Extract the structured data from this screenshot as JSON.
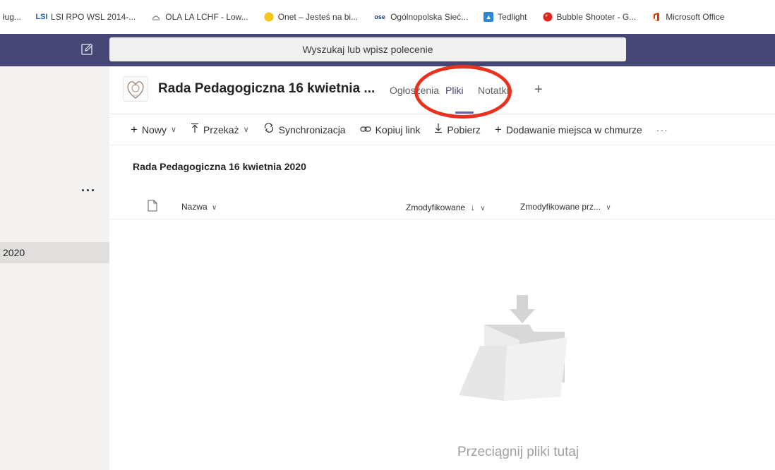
{
  "bookmarks": [
    {
      "label": "ług...",
      "icon": "bookmark-icon",
      "color": "#6b6b6b"
    },
    {
      "label": "LSI RPO WSL 2014-...",
      "icon": "lsi-logo-icon",
      "color": "#1f5ea8"
    },
    {
      "label": "OLA LA LCHF - Low...",
      "icon": "ola-icon",
      "color": "#8c8c8c"
    },
    {
      "label": "Onet – Jesteś na bi...",
      "icon": "onet-icon",
      "color": "#f5c518"
    },
    {
      "label": "Ogólnopolska Sieć...",
      "icon": "ose-icon",
      "color": "#1a3b73"
    },
    {
      "label": "Tedlight",
      "icon": "tedlight-icon",
      "color": "#2b88d8"
    },
    {
      "label": "Bubble Shooter - G...",
      "icon": "bubble-icon",
      "color": "#d9281e"
    },
    {
      "label": "Microsoft Office",
      "icon": "office-icon",
      "color": "#d83b01"
    }
  ],
  "topbar": {
    "search_placeholder": "Wyszukaj lub wpisz polecenie",
    "brand_color": "#464775"
  },
  "leftpanel": {
    "more": "···",
    "selected_item": "2020"
  },
  "channel": {
    "team_name": "Rada Pedagogiczna 16 kwietnia ...",
    "tabs": [
      {
        "label": "Ogłoszenia",
        "active": false
      },
      {
        "label": "Pliki",
        "active": true
      },
      {
        "label": "Notatki",
        "active": false
      }
    ],
    "add_tab": "+",
    "accent_color": "#6264a7",
    "annotation_color": "#e8321d"
  },
  "commands": {
    "new": "Nowy",
    "upload": "Przekaż",
    "sync": "Synchronizacja",
    "copy_link": "Kopiuj link",
    "download": "Pobierz",
    "add_cloud": "Dodawanie miejsca w chmurze",
    "more": "···"
  },
  "folder": {
    "title": "Rada Pedagogiczna 16 kwietnia 2020",
    "columns": {
      "name": "Nazwa",
      "modified": "Zmodyfikowane",
      "modified_by": "Zmodyfikowane prz..."
    },
    "empty_message": "Przeciągnij pliki tutaj"
  }
}
